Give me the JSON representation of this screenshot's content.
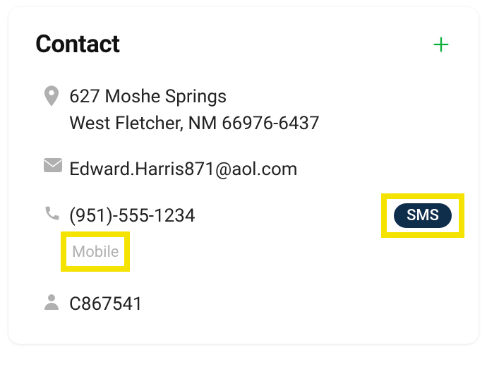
{
  "header": {
    "title": "Contact"
  },
  "address": {
    "line1": "627 Moshe Springs",
    "line2": "West Fletcher, NM 66976-6437"
  },
  "email": {
    "value": "Edward.Harris871@aol.com"
  },
  "phone": {
    "value": "(951)-555-1234",
    "type": "Mobile",
    "sms_label": "SMS"
  },
  "person_id": {
    "value": "C867541"
  }
}
